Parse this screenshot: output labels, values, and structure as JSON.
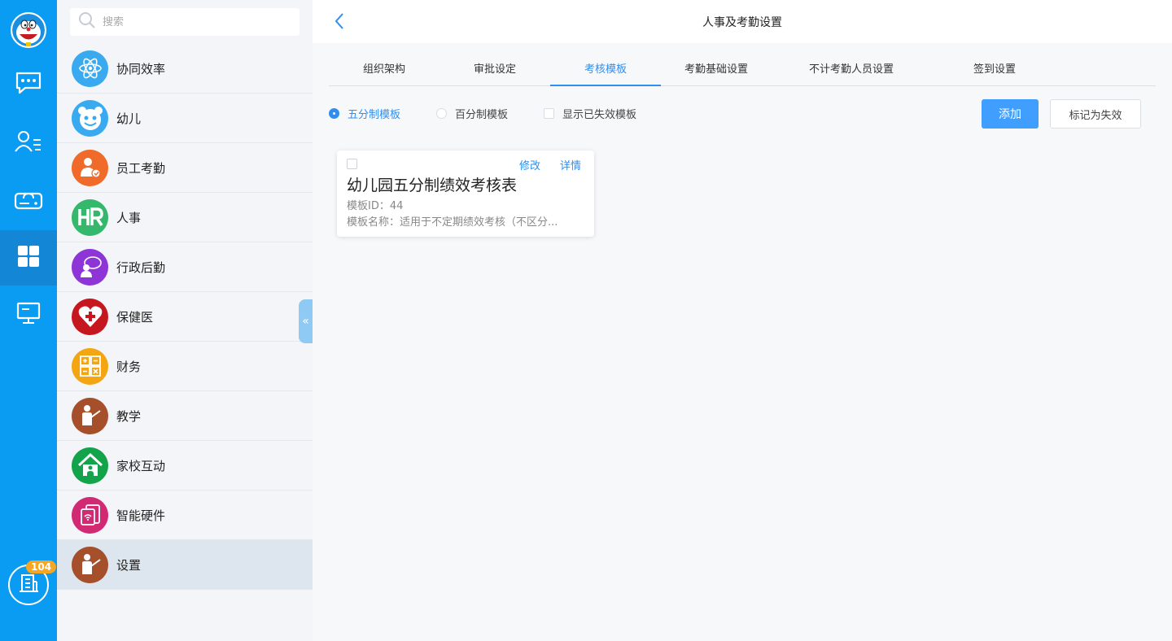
{
  "rail": {
    "badge_count": "104",
    "items": [
      "chat-icon",
      "contacts-icon",
      "cloud-drive-icon",
      "apps-icon",
      "monitor-icon"
    ]
  },
  "modules": {
    "search_placeholder": "搜索",
    "items": [
      {
        "label": "协同效率",
        "color": "#3aaaf0"
      },
      {
        "label": "幼儿",
        "color": "#3aaaf0"
      },
      {
        "label": "员工考勤",
        "color": "#f06a2a"
      },
      {
        "label": "人事",
        "color": "#35b86b"
      },
      {
        "label": "行政后勤",
        "color": "#8e35d8"
      },
      {
        "label": "保健医",
        "color": "#c7171e"
      },
      {
        "label": "财务",
        "color": "#f3a612"
      },
      {
        "label": "教学",
        "color": "#a64f2b"
      },
      {
        "label": "家校互动",
        "color": "#13a34a"
      },
      {
        "label": "智能硬件",
        "color": "#d12a72"
      },
      {
        "label": "设置",
        "color": "#a64f2b"
      }
    ]
  },
  "header": {
    "title": "人事及考勤设置"
  },
  "tabs": [
    "组织架构",
    "审批设定",
    "考核模板",
    "考勤基础设置",
    "不计考勤人员设置",
    "签到设置"
  ],
  "active_tab": "考核模板",
  "filters": {
    "five_point": "五分制模板",
    "hundred_point": "百分制模板",
    "show_invalid": "显示已失效模板"
  },
  "buttons": {
    "add": "添加",
    "mark_invalid": "标记为失效"
  },
  "card": {
    "edit": "修改",
    "detail": "详情",
    "title": "幼儿园五分制绩效考核表",
    "template_id": "模板ID：44",
    "template_name": "模板名称：适用于不定期绩效考核（不区分..."
  },
  "colors": {
    "rail": "#0a9bf2",
    "accent": "#2f8ef0",
    "primary_button": "#409eff"
  }
}
